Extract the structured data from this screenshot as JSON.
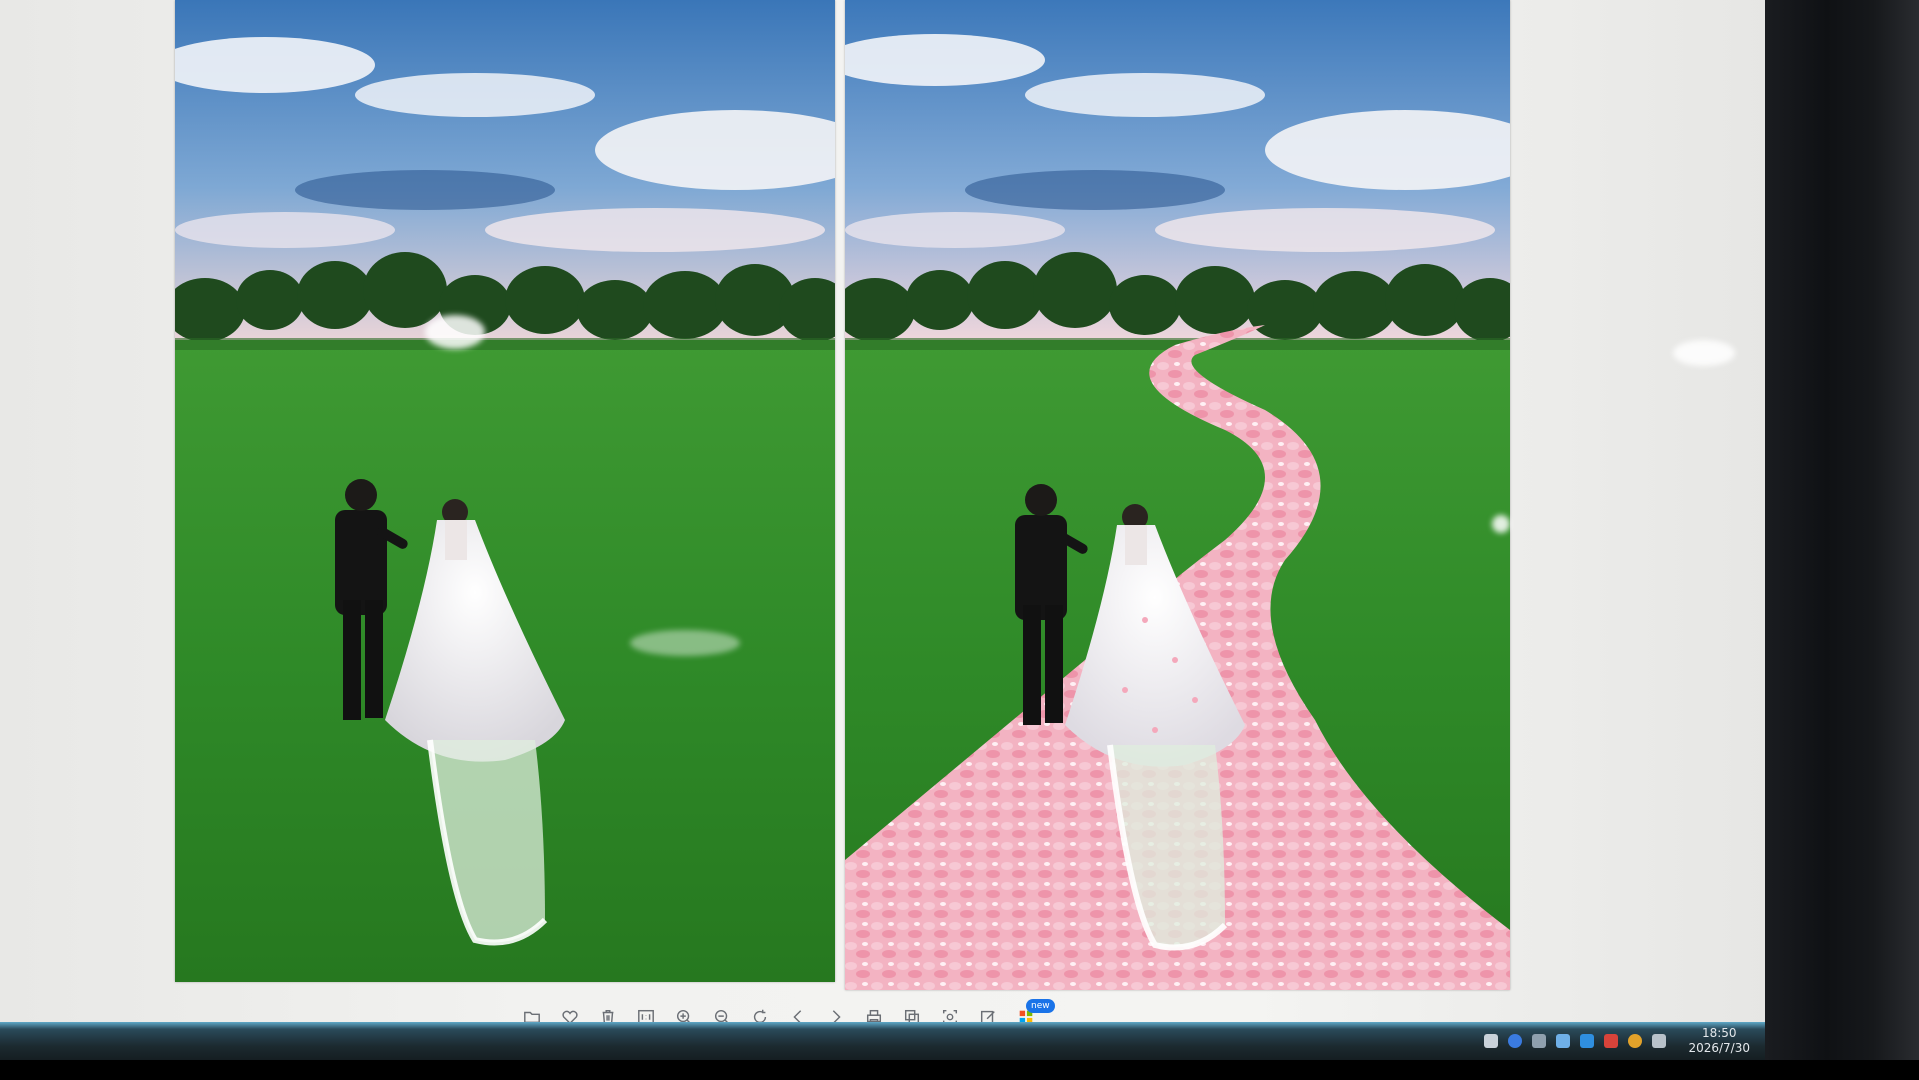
{
  "viewer": {
    "photos": [
      {
        "name": "left-photo",
        "has_petal_path": false
      },
      {
        "name": "right-photo",
        "has_petal_path": true
      }
    ]
  },
  "toolbar": {
    "buttons": [
      {
        "name": "open-folder-button",
        "icon": "folder-icon"
      },
      {
        "name": "favorite-button",
        "icon": "heart-icon"
      },
      {
        "name": "delete-button",
        "icon": "trash-icon"
      },
      {
        "name": "actual-size-button",
        "icon": "one-to-one-icon"
      },
      {
        "name": "zoom-in-button",
        "icon": "zoom-in-icon"
      },
      {
        "name": "zoom-out-button",
        "icon": "zoom-out-icon"
      },
      {
        "name": "rotate-button",
        "icon": "rotate-icon"
      },
      {
        "name": "previous-button",
        "icon": "chevron-left-icon"
      },
      {
        "name": "next-button",
        "icon": "chevron-right-icon"
      },
      {
        "name": "print-button",
        "icon": "printer-icon"
      },
      {
        "name": "compare-button",
        "icon": "copy-icon"
      },
      {
        "name": "screenshot-button",
        "icon": "crop-icon"
      },
      {
        "name": "edit-button",
        "icon": "pencil-icon"
      },
      {
        "name": "apps-button",
        "icon": "grid-icon"
      }
    ],
    "badge": "new"
  },
  "taskbar": {
    "clock_time": "18:50",
    "clock_date": "2026/7/30"
  },
  "colors": {
    "sky": "#4a86c6",
    "grass": "#2f8a2a",
    "petal": "#f2a0b4",
    "taskbar": "#1c2a30",
    "badge": "#1a73e8"
  }
}
